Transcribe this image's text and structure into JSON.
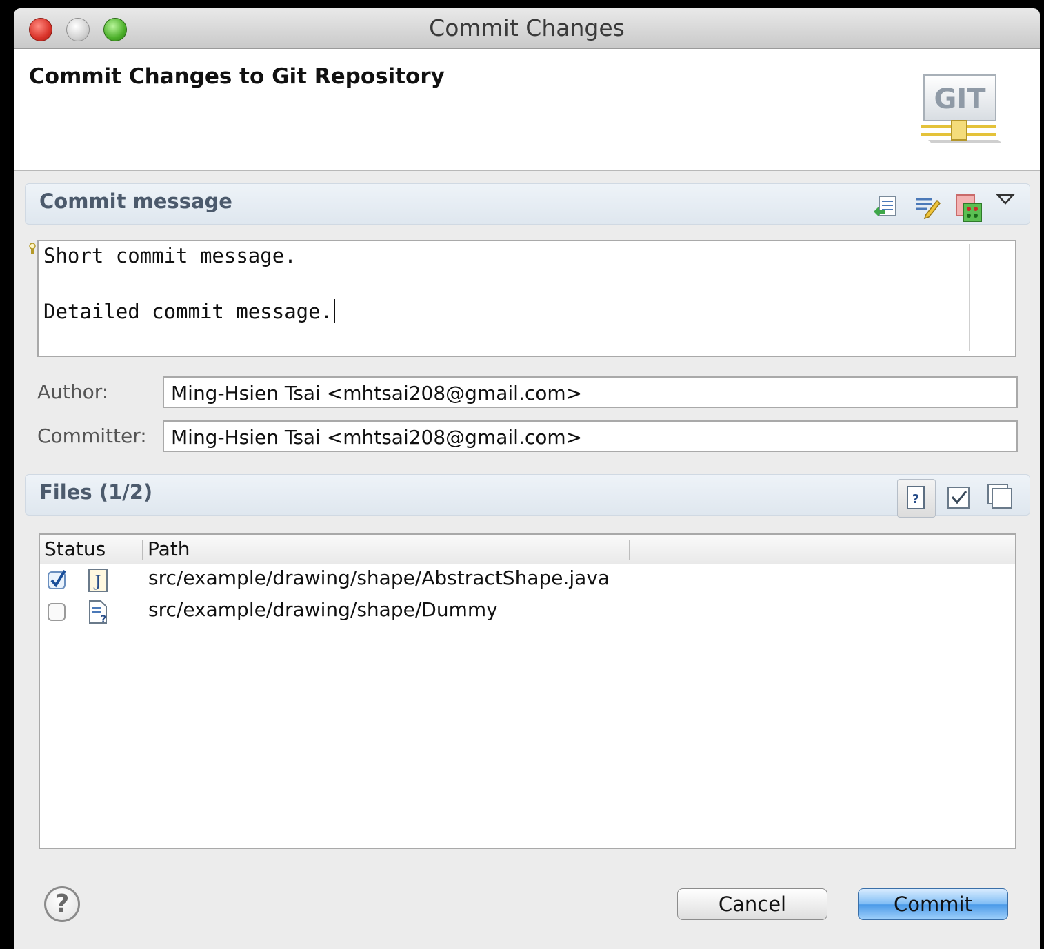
{
  "window": {
    "title": "Commit Changes"
  },
  "header": {
    "title": "Commit Changes to Git Repository",
    "logo_text": "GIT"
  },
  "commit_message": {
    "section_title": "Commit message",
    "lines": [
      "Short commit message.",
      "",
      "Detailed commit message."
    ],
    "toolbar": [
      "add-signed-off-by-icon",
      "amend-icon",
      "compare-icon",
      "view-menu-icon"
    ]
  },
  "author": {
    "label": "Author:",
    "value": "Ming-Hsien Tsai <mhtsai208@gmail.com>"
  },
  "committer": {
    "label": "Committer:",
    "value": "Ming-Hsien Tsai <mhtsai208@gmail.com>"
  },
  "files": {
    "section_title": "Files (1/2)",
    "toolbar": [
      "show-untracked-icon",
      "select-all-icon",
      "deselect-all-icon"
    ],
    "columns": [
      "Status",
      "Path"
    ],
    "rows": [
      {
        "checked": true,
        "icon": "java-file-icon",
        "path": "src/example/drawing/shape/AbstractShape.java"
      },
      {
        "checked": false,
        "icon": "untracked-file-icon",
        "path": "src/example/drawing/shape/Dummy"
      }
    ]
  },
  "footer": {
    "help": "?",
    "cancel_label": "Cancel",
    "commit_label": "Commit"
  },
  "colors": {
    "accent": "#4a9ae8",
    "section_bg": "#dfe7ef",
    "section_text": "#4c5a6c"
  }
}
